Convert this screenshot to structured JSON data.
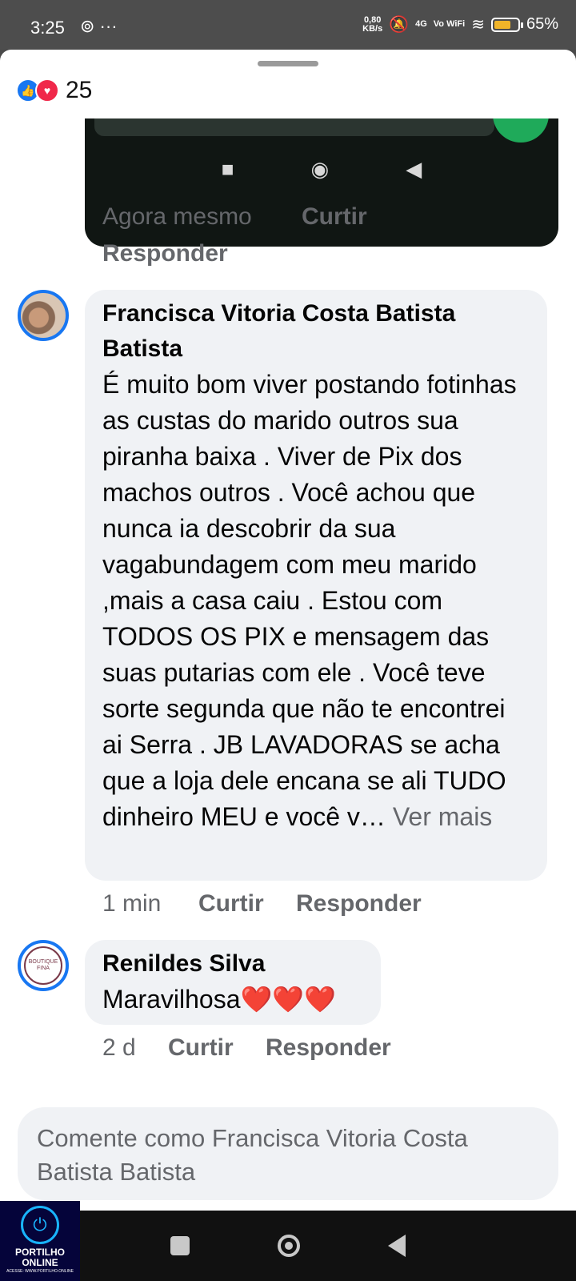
{
  "status_bar": {
    "time": "3:25",
    "extra": "⊚ ···",
    "net_speed_value": "0,80",
    "net_speed_unit": "KB/s",
    "signal": "4G",
    "vowifi": "Vo WiFi",
    "battery": "65%",
    "battery_level": 0.65
  },
  "reactions": {
    "like_glyph": "👍",
    "love_glyph": "♥",
    "count": "25"
  },
  "image_preview": {
    "nav_square": "■",
    "nav_home": "◉",
    "nav_back": "◀"
  },
  "first_comment_meta": {
    "time": "Agora mesmo",
    "like": "Curtir",
    "reply": "Responder"
  },
  "comments": [
    {
      "author": "Francisca Vitoria Costa Batista Batista",
      "text": "É muito bom viver postando fotinhas as custas do marido outros sua piranha baixa . Viver de Pix dos machos outros . Você achou que nunca ia descobrir da sua vagabundagem com meu marido ,mais a casa caiu . Estou com TODOS OS PIX e mensagem das suas putarias com ele . Você teve sorte segunda que não te encontrei ai Serra . JB LAVADORAS se acha que a loja dele encana se ali TUDO dinheiro MEU e você v…",
      "see_more": "Ver mais",
      "time": "1 min",
      "like": "Curtir",
      "reply": "Responder"
    },
    {
      "author": "Renildes Silva",
      "text": "Maravilhosa❤️❤️❤️",
      "time": "2 d",
      "like": "Curtir",
      "reply": "Responder",
      "avatar_text": "BOUTIQUE FINA"
    }
  ],
  "composer": {
    "placeholder": "Comente como Francisca Vitoria Costa Batista Batista"
  },
  "watermark": {
    "name": "PORTILHO ONLINE",
    "url": "ACESSE: WWW.PORTILHO.ONLINE"
  },
  "colors": {
    "facebook_blue": "#1877f2",
    "bubble_bg": "#f0f2f5",
    "meta_gray": "#65676b"
  }
}
